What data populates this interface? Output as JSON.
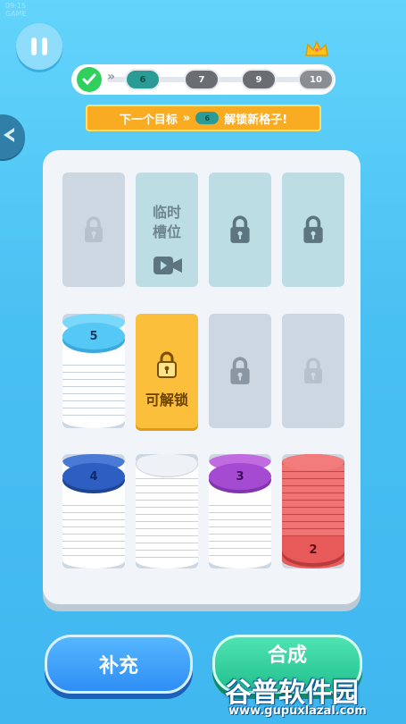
{
  "top_status": {
    "line1": "09:15",
    "line2": "GAME"
  },
  "progress": {
    "levels": [
      {
        "label": "6",
        "state": "current"
      },
      {
        "label": "7",
        "state": "locked"
      },
      {
        "label": "9",
        "state": "locked"
      },
      {
        "label": "10",
        "state": "final"
      }
    ]
  },
  "goal": {
    "prefix": "下一个目标",
    "target": "6",
    "suffix": "解锁新格子!"
  },
  "board": {
    "temp_slot_label_1": "临时",
    "temp_slot_label_2": "槽位",
    "unlockable_label": "可解锁",
    "stacks": [
      {
        "number": "5",
        "color": "#55c8f5"
      },
      {
        "number": "4",
        "color": "#2d5fc3"
      },
      {
        "number": "3",
        "color": "#a44bd1"
      },
      {
        "number": "2",
        "color": "#e85a5a"
      }
    ]
  },
  "buttons": {
    "refill": "补充",
    "merge": "合成"
  },
  "watermark": {
    "title": "谷普软件园",
    "url": "www.gupuxlazal.com"
  }
}
